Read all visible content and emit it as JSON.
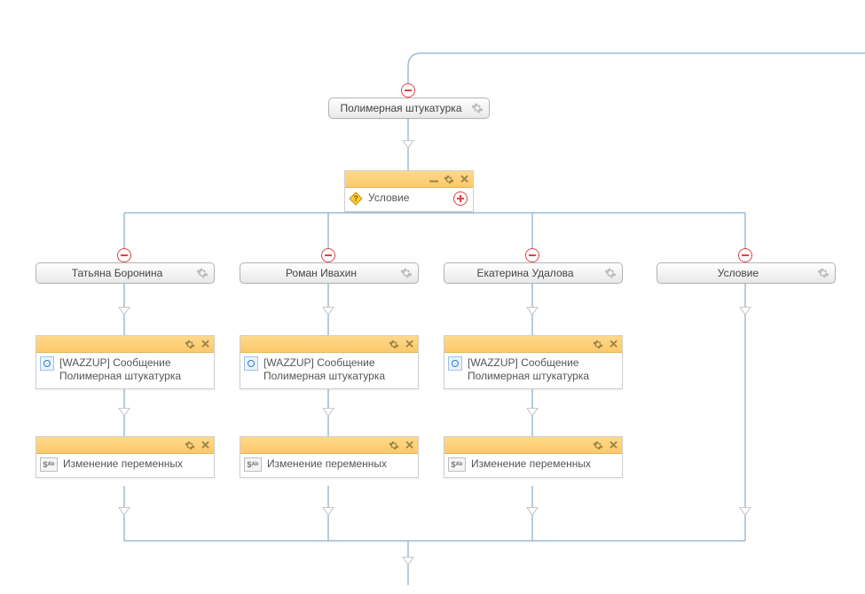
{
  "root": {
    "label": "Полимерная штукатурка"
  },
  "condition_card": {
    "title": "Условие"
  },
  "branches": [
    {
      "label": "Татьяна Боронина"
    },
    {
      "label": "Роман Ивахин"
    },
    {
      "label": "Екатерина Удалова"
    },
    {
      "label": "Условие"
    }
  ],
  "wazzup": {
    "line1": "[WAZZUP] Сообщение",
    "line2": "Полимерная штукатурка"
  },
  "varchange": {
    "label": "Изменение переменных"
  },
  "sab_icon_text": "$ᴬᵇ"
}
